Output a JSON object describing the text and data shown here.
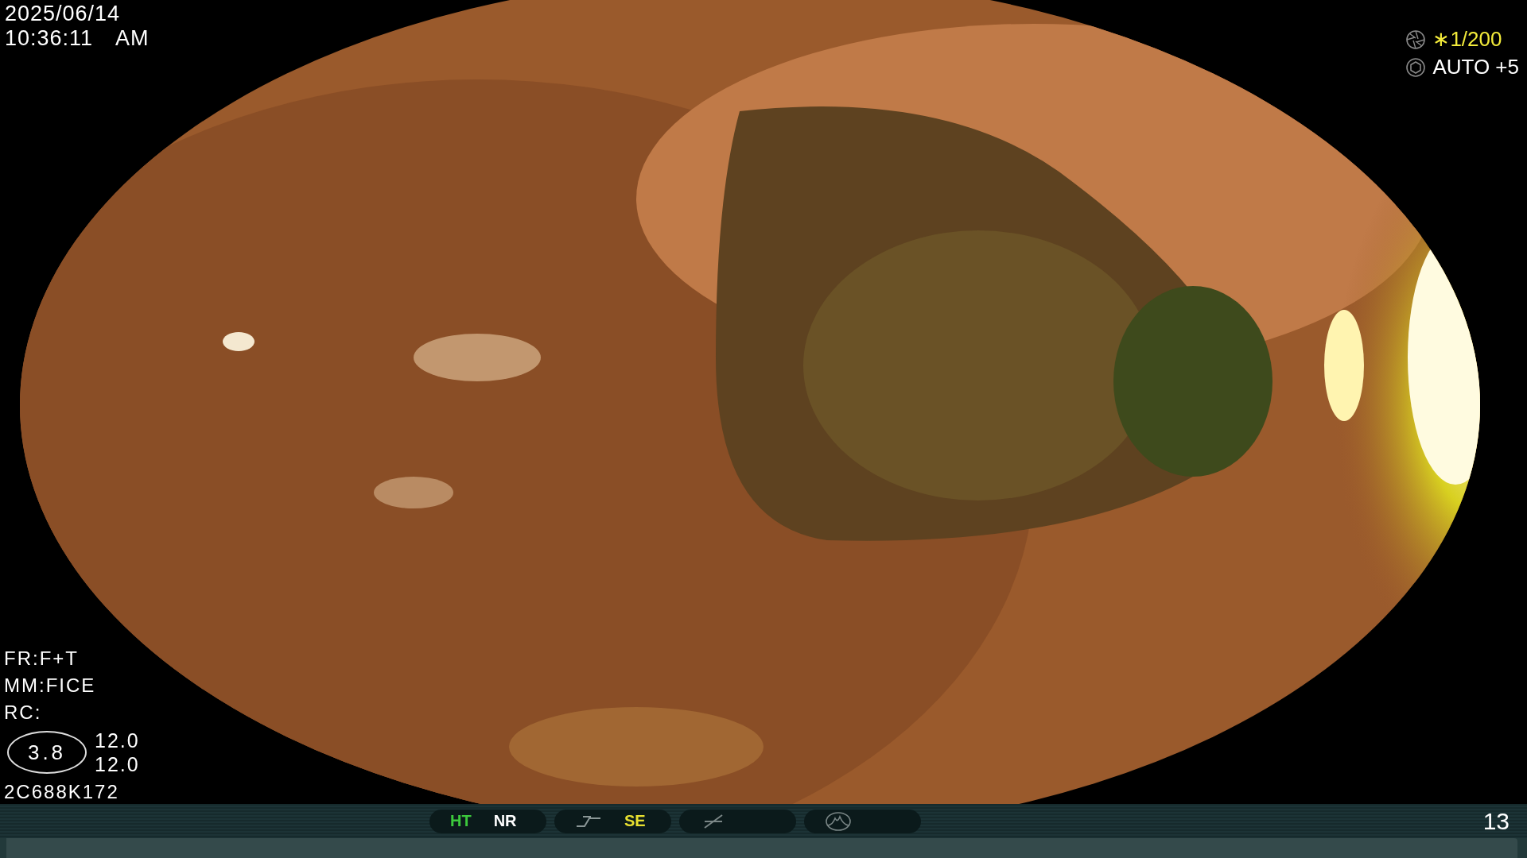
{
  "datetime": {
    "date": "2025/06/14",
    "time": "10:36:11",
    "meridiem": "AM"
  },
  "exposure": [
    {
      "kind": "shutter",
      "text": "∗1/200",
      "color": "#f2ea3a"
    },
    {
      "kind": "iris",
      "text": "AUTO +5",
      "color": "#ffffff"
    }
  ],
  "settings": [
    "FR:F+T",
    "MM:FICE",
    "RC:"
  ],
  "zoom": {
    "value": "3.8",
    "readings": [
      "12.0",
      "12.0"
    ]
  },
  "scope_id": "2C688K172",
  "status_bar": {
    "groups": [
      {
        "kind": "labels",
        "labels": [
          {
            "text": "HT",
            "color": "#3cc83c"
          },
          {
            "text": "NR",
            "color": "#ffffff"
          }
        ]
      },
      {
        "kind": "curve",
        "labels": [
          {
            "text": "SE",
            "color": "#e8e030"
          }
        ]
      },
      {
        "kind": "slash"
      },
      {
        "kind": "wave"
      }
    ],
    "counter": "13"
  }
}
